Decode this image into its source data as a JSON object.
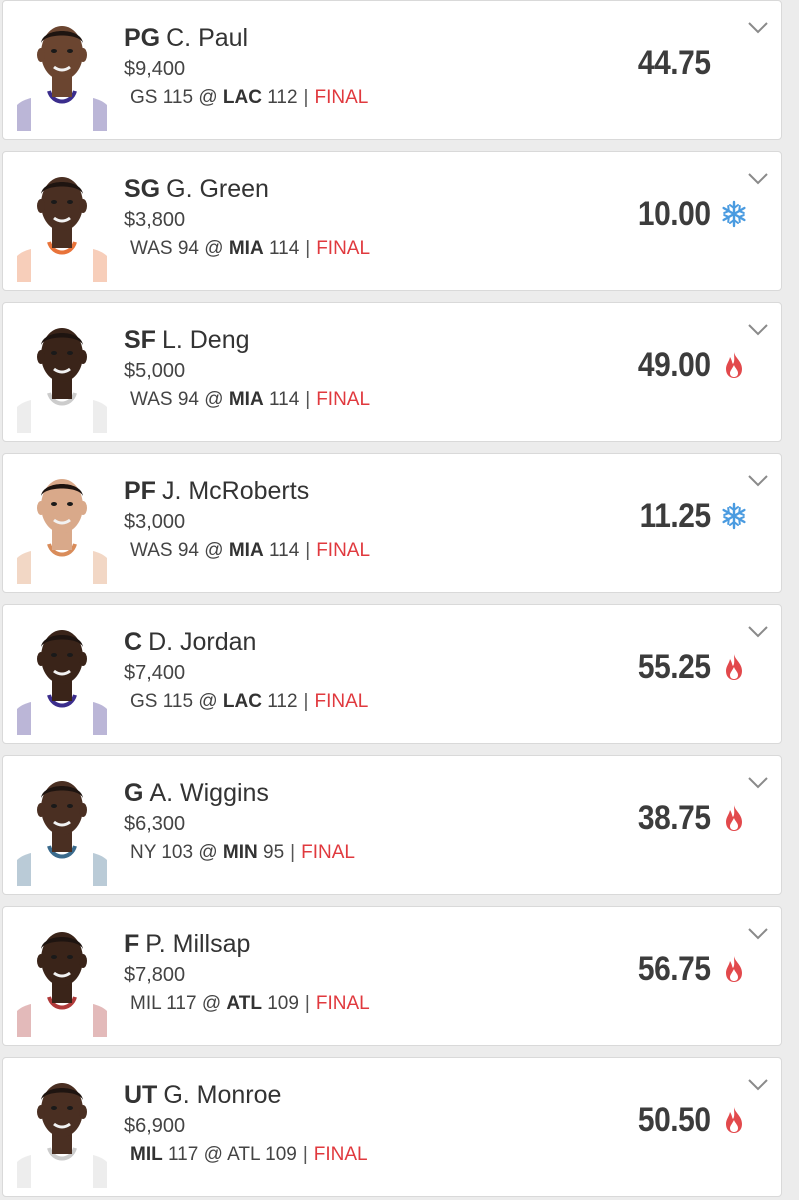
{
  "players": [
    {
      "pos": "PG",
      "name": "C. Paul",
      "salary": "$9,400",
      "away": "GS",
      "away_score": "115",
      "at": "@",
      "home": "LAC",
      "home_score": "112",
      "bold_side": "home",
      "status": "FINAL",
      "points": "44.75",
      "icon": "none",
      "skin": "#6b4530",
      "jersey": "#ffffff",
      "trim": "#3b2d8c"
    },
    {
      "pos": "SG",
      "name": "G. Green",
      "salary": "$3,800",
      "away": "WAS",
      "away_score": "94",
      "at": "@",
      "home": "MIA",
      "home_score": "114",
      "bold_side": "home",
      "status": "FINAL",
      "points": "10.00",
      "icon": "snowflake-icon",
      "skin": "#4a2f22",
      "jersey": "#ffffff",
      "trim": "#e8733a"
    },
    {
      "pos": "SF",
      "name": "L. Deng",
      "salary": "$5,000",
      "away": "WAS",
      "away_score": "94",
      "at": "@",
      "home": "MIA",
      "home_score": "114",
      "bold_side": "home",
      "status": "FINAL",
      "points": "49.00",
      "icon": "fire-icon",
      "skin": "#3a2419",
      "jersey": "#ffffff",
      "trim": "#cccccc"
    },
    {
      "pos": "PF",
      "name": "J. McRoberts",
      "salary": "$3,000",
      "away": "WAS",
      "away_score": "94",
      "at": "@",
      "home": "MIA",
      "home_score": "114",
      "bold_side": "home",
      "status": "FINAL",
      "points": "11.25",
      "icon": "snowflake-icon",
      "skin": "#d9a98a",
      "jersey": "#ffffff",
      "trim": "#d98c5a"
    },
    {
      "pos": "C",
      "name": "D. Jordan",
      "salary": "$7,400",
      "away": "GS",
      "away_score": "115",
      "at": "@",
      "home": "LAC",
      "home_score": "112",
      "bold_side": "home",
      "status": "FINAL",
      "points": "55.25",
      "icon": "fire-icon",
      "skin": "#3a2419",
      "jersey": "#ffffff",
      "trim": "#3b2d8c"
    },
    {
      "pos": "G",
      "name": "A. Wiggins",
      "salary": "$6,300",
      "away": "NY",
      "away_score": "103",
      "at": "@",
      "home": "MIN",
      "home_score": "95",
      "bold_side": "home",
      "status": "FINAL",
      "points": "38.75",
      "icon": "fire-icon",
      "skin": "#4a2f22",
      "jersey": "#ffffff",
      "trim": "#3a6a8c"
    },
    {
      "pos": "F",
      "name": "P. Millsap",
      "salary": "$7,800",
      "away": "MIL",
      "away_score": "117",
      "at": "@",
      "home": "ATL",
      "home_score": "109",
      "bold_side": "home",
      "status": "FINAL",
      "points": "56.75",
      "icon": "fire-icon",
      "skin": "#3a2419",
      "jersey": "#ffffff",
      "trim": "#b03a3a"
    },
    {
      "pos": "UT",
      "name": "G. Monroe",
      "salary": "$6,900",
      "away": "MIL",
      "away_score": "117",
      "at": "@",
      "home": "ATL",
      "home_score": "109",
      "bold_side": "away",
      "status": "FINAL",
      "points": "50.50",
      "icon": "fire-icon",
      "skin": "#4a2f22",
      "jersey": "#ffffff",
      "trim": "#cccccc"
    }
  ],
  "colors": {
    "final": "#e0393e",
    "fire": "#e2494c",
    "snowflake": "#4a9be0",
    "points": "#3c3c3c"
  }
}
